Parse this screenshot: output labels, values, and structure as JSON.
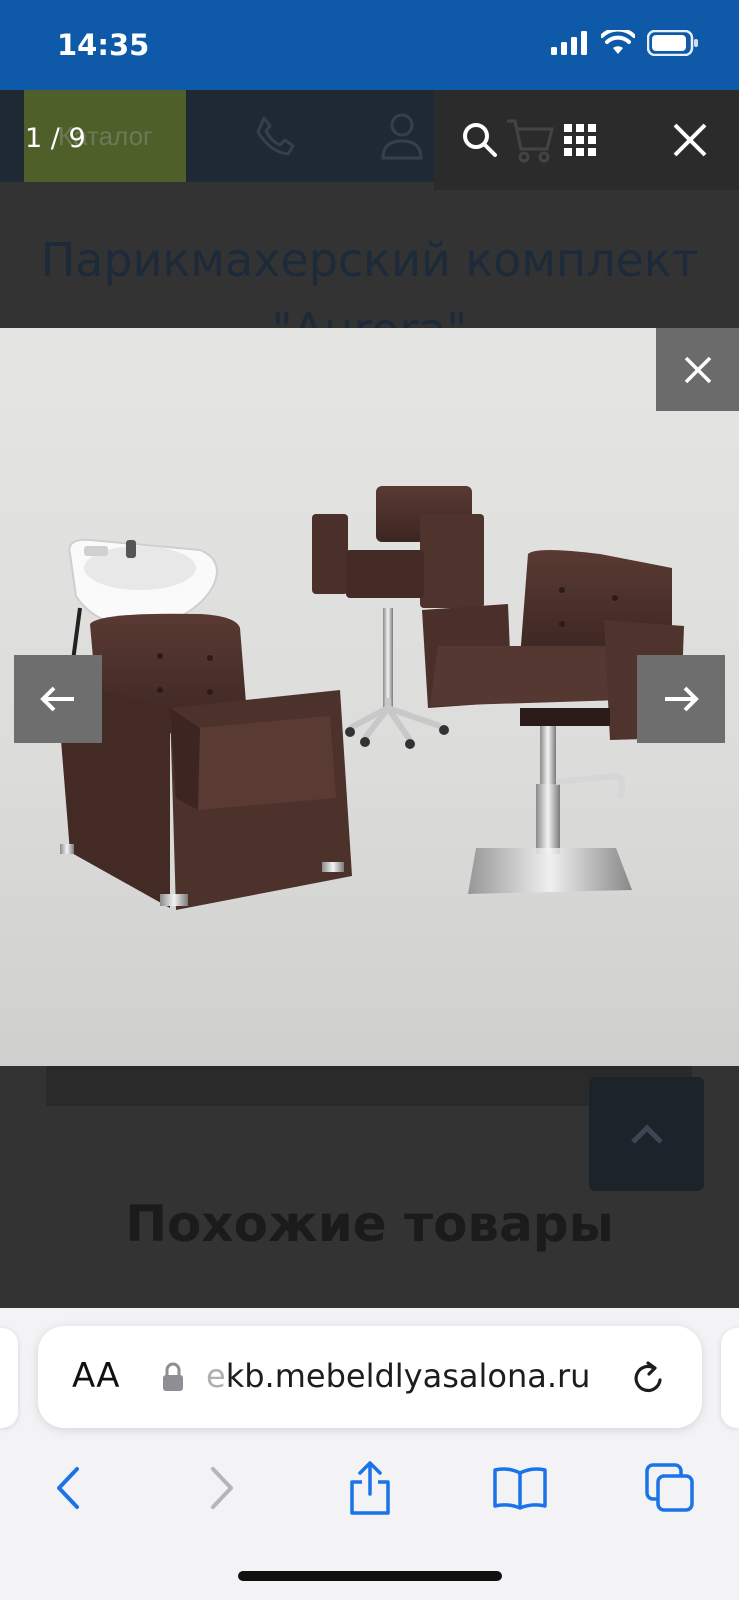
{
  "status_bar": {
    "time": "14:35"
  },
  "site_header": {
    "catalog_label": "Каталог"
  },
  "page": {
    "title_dimmed": "Парикмахерский комплект \"Aurora\"",
    "similar_heading": "Похожие товары"
  },
  "lightbox": {
    "counter": "1 / 9",
    "image_alt": "Парикмахерский комплект Aurora: мойка, детское кресло, парикмахерское кресло"
  },
  "browser": {
    "aa_label": "AA",
    "url_faded": "e",
    "url": "kb.mebeldlyasalona.ru"
  },
  "colors": {
    "status_bar": "#0f5aa8",
    "chair_leather": "#4a302b",
    "safari_blue": "#1a73e8"
  }
}
